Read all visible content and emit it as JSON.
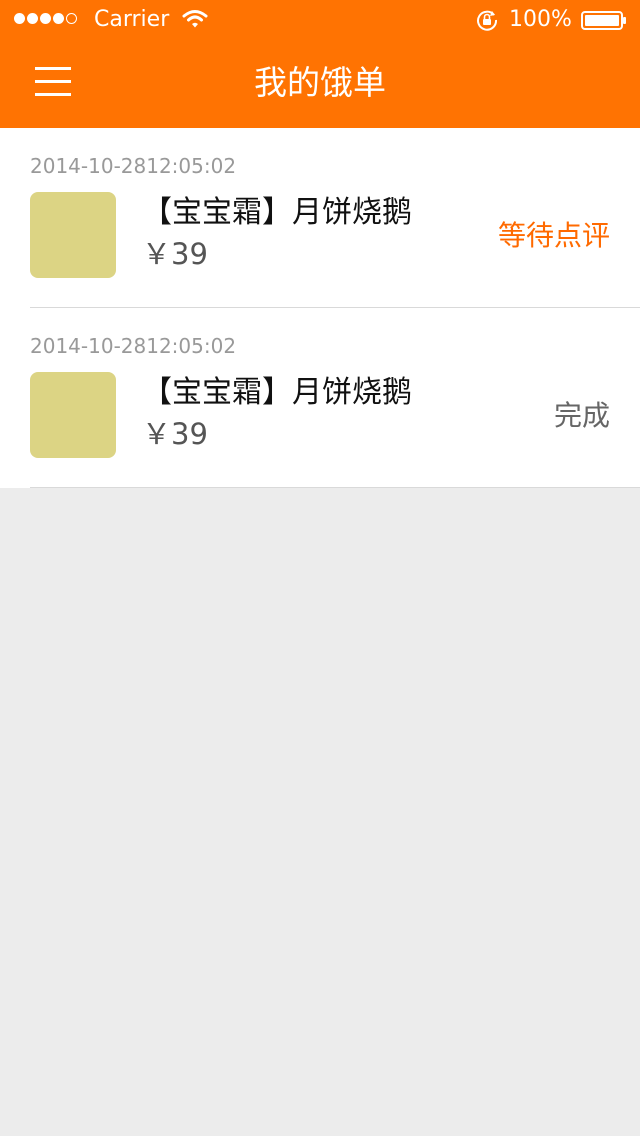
{
  "status_bar": {
    "carrier": "Carrier",
    "battery": "100%",
    "icons": [
      "signal-dots-icon",
      "wifi-icon",
      "rotation-lock-icon",
      "battery-icon"
    ]
  },
  "header": {
    "title": "我的饿单",
    "menu_icon": "hamburger-menu-icon",
    "background_color": "#ff7302"
  },
  "orders": [
    {
      "date": "2014-10-2812:05:02",
      "name": "【宝宝霜】月饼烧鹅",
      "price": "￥39",
      "status": "等待点评",
      "status_color": "#ff6a00"
    },
    {
      "date": "2014-10-2812:05:02",
      "name": "【宝宝霜】月饼烧鹅",
      "price": "￥39",
      "status": "完成",
      "status_color": "#666666"
    }
  ]
}
